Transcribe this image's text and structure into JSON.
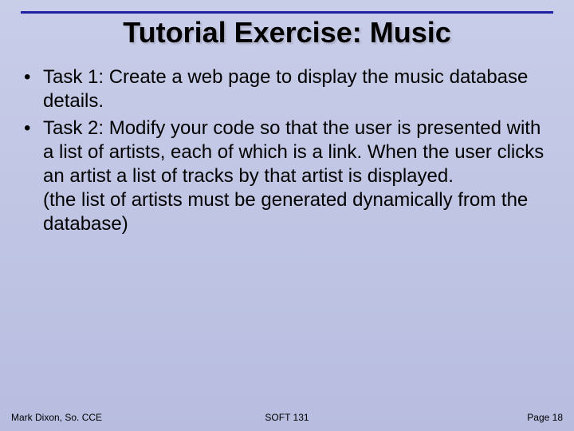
{
  "title": "Tutorial Exercise: Music",
  "bullets": [
    {
      "marker": "•",
      "text": "Task 1: Create a web page to display the music database details."
    },
    {
      "marker": "•",
      "text": "Task 2: Modify your code so that the user is presented with a list of artists, each of which is a link. When the user clicks an artist a list of tracks by that artist is displayed.\n(the list of artists must be generated dynamically from the database)"
    }
  ],
  "footer": {
    "left": "Mark Dixon, So. CCE",
    "center": "SOFT 131",
    "right": "Page 18"
  }
}
